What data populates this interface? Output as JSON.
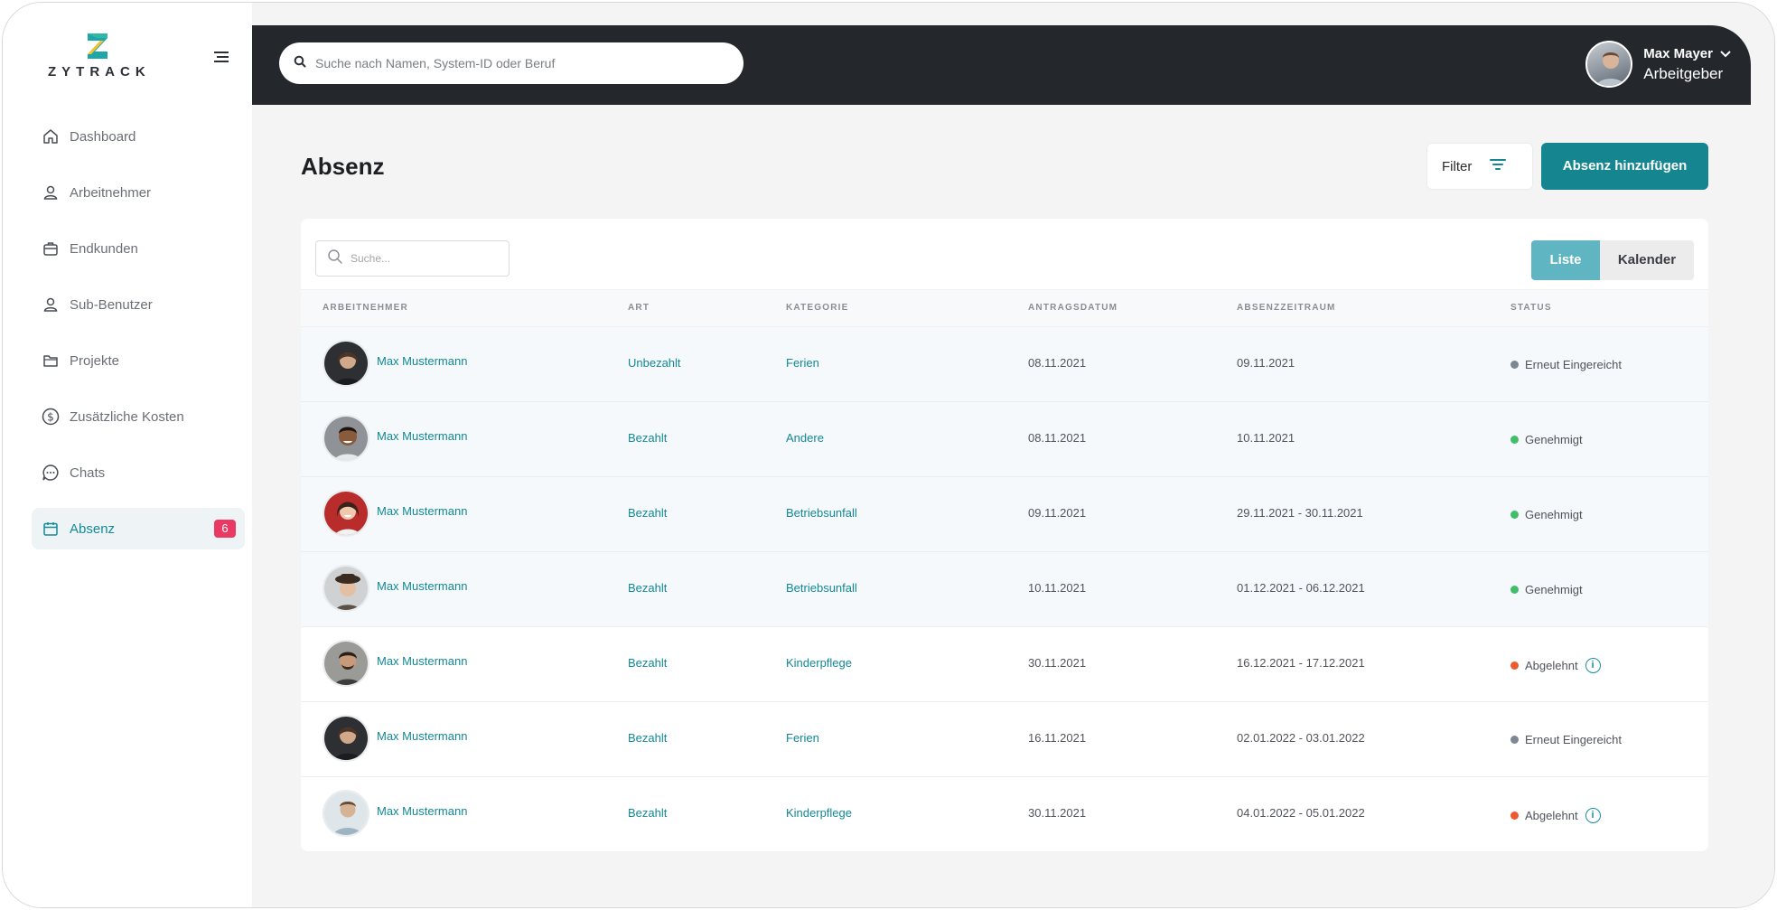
{
  "brand": {
    "name": "ZYTRACK"
  },
  "sidebar": {
    "items": [
      {
        "label": "Dashboard",
        "icon": "home-icon"
      },
      {
        "label": "Arbeitnehmer",
        "icon": "user-icon"
      },
      {
        "label": "Endkunden",
        "icon": "briefcase-icon"
      },
      {
        "label": "Sub-Benutzer",
        "icon": "user-outline-icon"
      },
      {
        "label": "Projekte",
        "icon": "folder-icon"
      },
      {
        "label": "Zusätzliche Kosten",
        "icon": "dollar-icon"
      },
      {
        "label": "Chats",
        "icon": "chat-icon"
      },
      {
        "label": "Absenz",
        "icon": "calendar-icon",
        "active": true,
        "badge": "6"
      }
    ]
  },
  "topbar": {
    "search_placeholder": "Suche nach Namen, System-ID oder Beruf",
    "user": {
      "name": "Max Mayer",
      "role": "Arbeitgeber"
    }
  },
  "page": {
    "title": "Absenz",
    "filter_label": "Filter",
    "add_label": "Absenz hinzufügen"
  },
  "table": {
    "search_placeholder": "Suche...",
    "view_list": "Liste",
    "view_calendar": "Kalender",
    "columns": [
      "ARBEITNEHMER",
      "ART",
      "KATEGORIE",
      "ANTRAGSDATUM",
      "ABSENZZEITRAUM",
      "STATUS"
    ],
    "rows": [
      {
        "name": "Max Mustermann",
        "art": "Unbezahlt",
        "kategorie": "Ferien",
        "antragsdatum": "08.11.2021",
        "zeitraum": "09.11.2021",
        "status": "Erneut Eingereicht",
        "status_color": "#7d8794",
        "info": false
      },
      {
        "name": "Max Mustermann",
        "art": "Bezahlt",
        "kategorie": "Andere",
        "antragsdatum": "08.11.2021",
        "zeitraum": "10.11.2021",
        "status": "Genehmigt",
        "status_color": "#3fbf6a",
        "info": false
      },
      {
        "name": "Max Mustermann",
        "art": "Bezahlt",
        "kategorie": "Betriebsunfall",
        "antragsdatum": "09.11.2021",
        "zeitraum": "29.11.2021 - 30.11.2021",
        "status": "Genehmigt",
        "status_color": "#3fbf6a",
        "info": false
      },
      {
        "name": "Max Mustermann",
        "art": "Bezahlt",
        "kategorie": "Betriebsunfall",
        "antragsdatum": "10.11.2021",
        "zeitraum": "01.12.2021 - 06.12.2021",
        "status": "Genehmigt",
        "status_color": "#3fbf6a",
        "info": false
      },
      {
        "name": "Max Mustermann",
        "art": "Bezahlt",
        "kategorie": "Kinderpflege",
        "antragsdatum": "30.11.2021",
        "zeitraum": "16.12.2021 - 17.12.2021",
        "status": "Abgelehnt",
        "status_color": "#ee5a2f",
        "info": true
      },
      {
        "name": "Max Mustermann",
        "art": "Bezahlt",
        "kategorie": "Ferien",
        "antragsdatum": "16.11.2021",
        "zeitraum": "02.01.2022 - 03.01.2022",
        "status": "Erneut Eingereicht",
        "status_color": "#7d8794",
        "info": false
      },
      {
        "name": "Max Mustermann",
        "art": "Bezahlt",
        "kategorie": "Kinderpflege",
        "antragsdatum": "30.11.2021",
        "zeitraum": "04.01.2022 - 05.01.2022",
        "status": "Abgelehnt",
        "status_color": "#ee5a2f",
        "info": true
      }
    ]
  },
  "colors": {
    "accent": "#15868f",
    "topbar": "#24272c",
    "badge": "#ea3a63"
  }
}
